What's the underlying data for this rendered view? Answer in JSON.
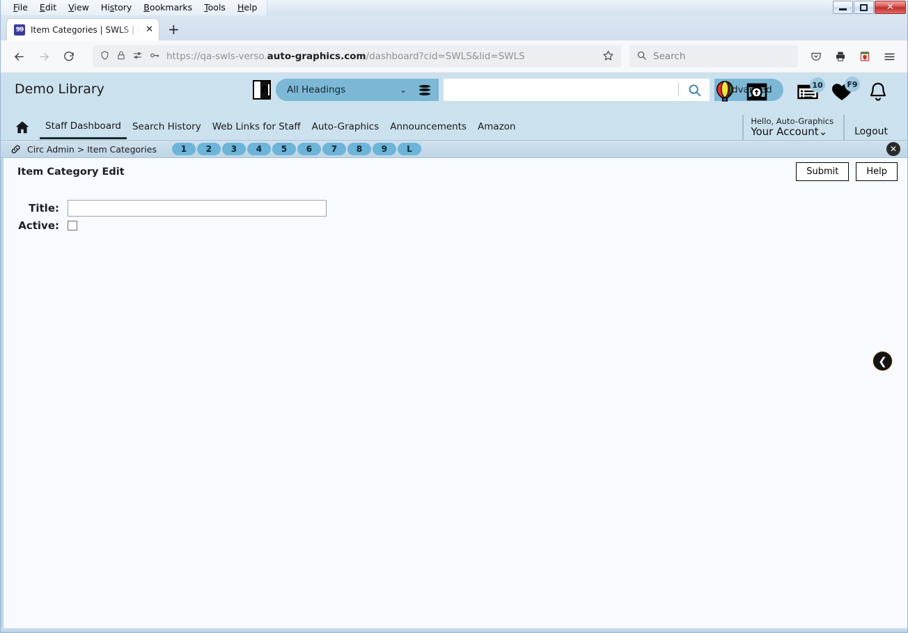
{
  "browser": {
    "menus": [
      "File",
      "Edit",
      "View",
      "History",
      "Bookmarks",
      "Tools",
      "Help"
    ],
    "tab": {
      "title": "Item Categories | SWLS | swls | A",
      "favicon": "book-favicon",
      "close_label": "✕",
      "newtab_label": "+"
    },
    "window_controls": {
      "minimize": "minimize-icon",
      "restore": "restore-icon",
      "close": "✕"
    },
    "toolbar": {
      "back": "←",
      "forward": "→",
      "reload": "⟳",
      "shield_icon": "shield-icon",
      "lock_icon": "lock-icon",
      "permissions_icon": "permissions-icon",
      "key_icon": "key-icon",
      "bookmark_star": "☆",
      "url_prefix": "https://qa-swls-verso.",
      "url_domain": "auto-graphics.com",
      "url_suffix": "/dashboard?cid=SWLS&lid=SWLS",
      "search_placeholder": "Search",
      "pocket_icon": "pocket-icon",
      "print_icon": "print-icon",
      "extension_icon": "extension-icon",
      "menu_icon": "hamburger-menu-icon"
    }
  },
  "app": {
    "library_name": "Demo Library",
    "search": {
      "lang_icon": "translate-icon",
      "scope_selected": "All Headings",
      "scope_chevron": "⌄",
      "database_icon": "database-icon",
      "query_value": "",
      "query_placeholder": "",
      "go_icon": "search-icon",
      "advanced_label": "Advanced"
    },
    "header_icons": [
      {
        "name": "balloon-icon",
        "badge": ""
      },
      {
        "name": "image-search-icon",
        "badge": ""
      },
      {
        "name": "list-icon",
        "badge": "10"
      },
      {
        "name": "heart-icon",
        "badge": "F9"
      },
      {
        "name": "bell-icon",
        "badge": ""
      }
    ],
    "nav": {
      "home_icon": "home-icon",
      "links": [
        {
          "label": "Staff Dashboard",
          "active": true
        },
        {
          "label": "Search History",
          "active": false
        },
        {
          "label": "Web Links for Staff",
          "active": false
        },
        {
          "label": "Auto-Graphics",
          "active": false
        },
        {
          "label": "Announcements",
          "active": false
        },
        {
          "label": "Amazon",
          "active": false
        }
      ]
    },
    "account": {
      "hello": "Hello, Auto-Graphics",
      "your_account": "Your Account",
      "account_chevron": "⌄",
      "logout": "Logout"
    },
    "breadcrumb": {
      "chain_icon": "link-icon",
      "text": "Circ Admin > Item Categories",
      "pages": [
        "1",
        "2",
        "3",
        "4",
        "5",
        "6",
        "7",
        "8",
        "9",
        "L"
      ],
      "close_label": "✕"
    },
    "content": {
      "form_title": "Item Category Edit",
      "buttons": [
        {
          "label": "Submit",
          "name": "submit-button"
        },
        {
          "label": "Help",
          "name": "help-button"
        }
      ],
      "fields": {
        "title_label": "Title:",
        "title_value": "",
        "title_placeholder": "",
        "active_label": "Active:",
        "active_checked": false
      },
      "collapse_icon": "❮"
    }
  },
  "colors": {
    "header_bg": "#cce1ee",
    "accent": "#7cb8d6",
    "pill": "#6cb4d8",
    "page_bg": "#f7fbff",
    "badge": "#9ec9e0"
  }
}
